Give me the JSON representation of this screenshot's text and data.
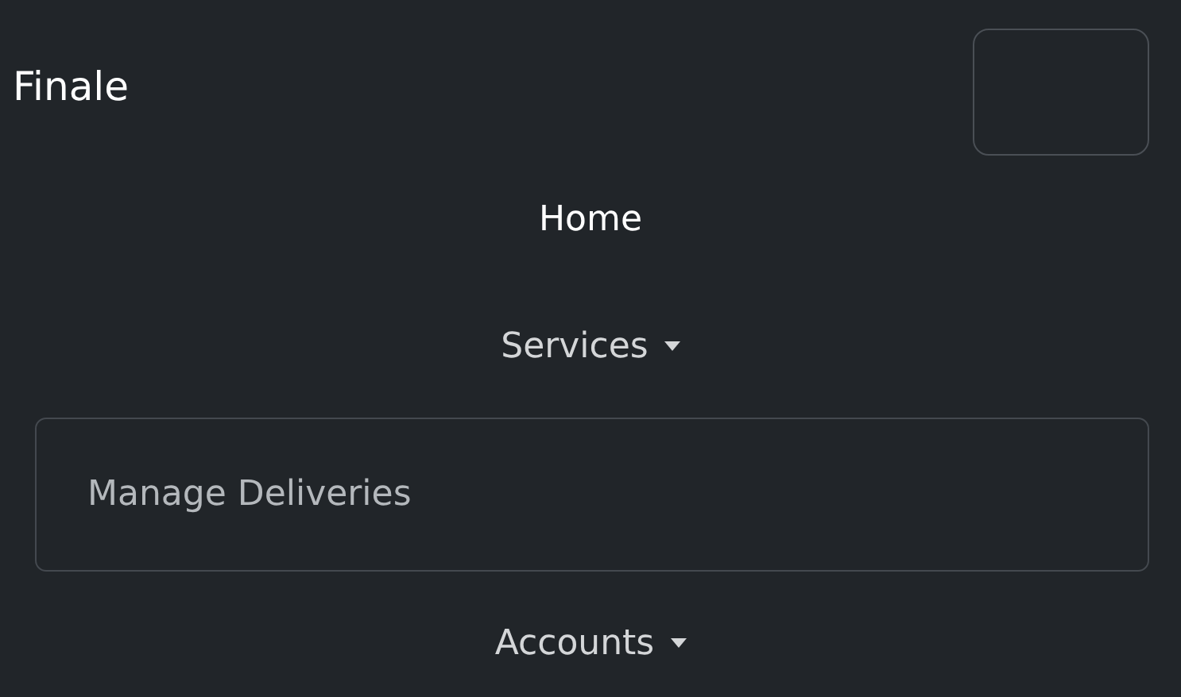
{
  "navbar": {
    "brand": "Finale",
    "items": [
      {
        "kind": "link",
        "label": "Home",
        "selected": true
      },
      {
        "kind": "dropdown",
        "label": "Services",
        "selected": false,
        "expanded": true,
        "menu": [
          "Manage Deliveries"
        ]
      },
      {
        "kind": "dropdown",
        "label": "Accounts",
        "selected": false,
        "expanded": false
      }
    ]
  }
}
